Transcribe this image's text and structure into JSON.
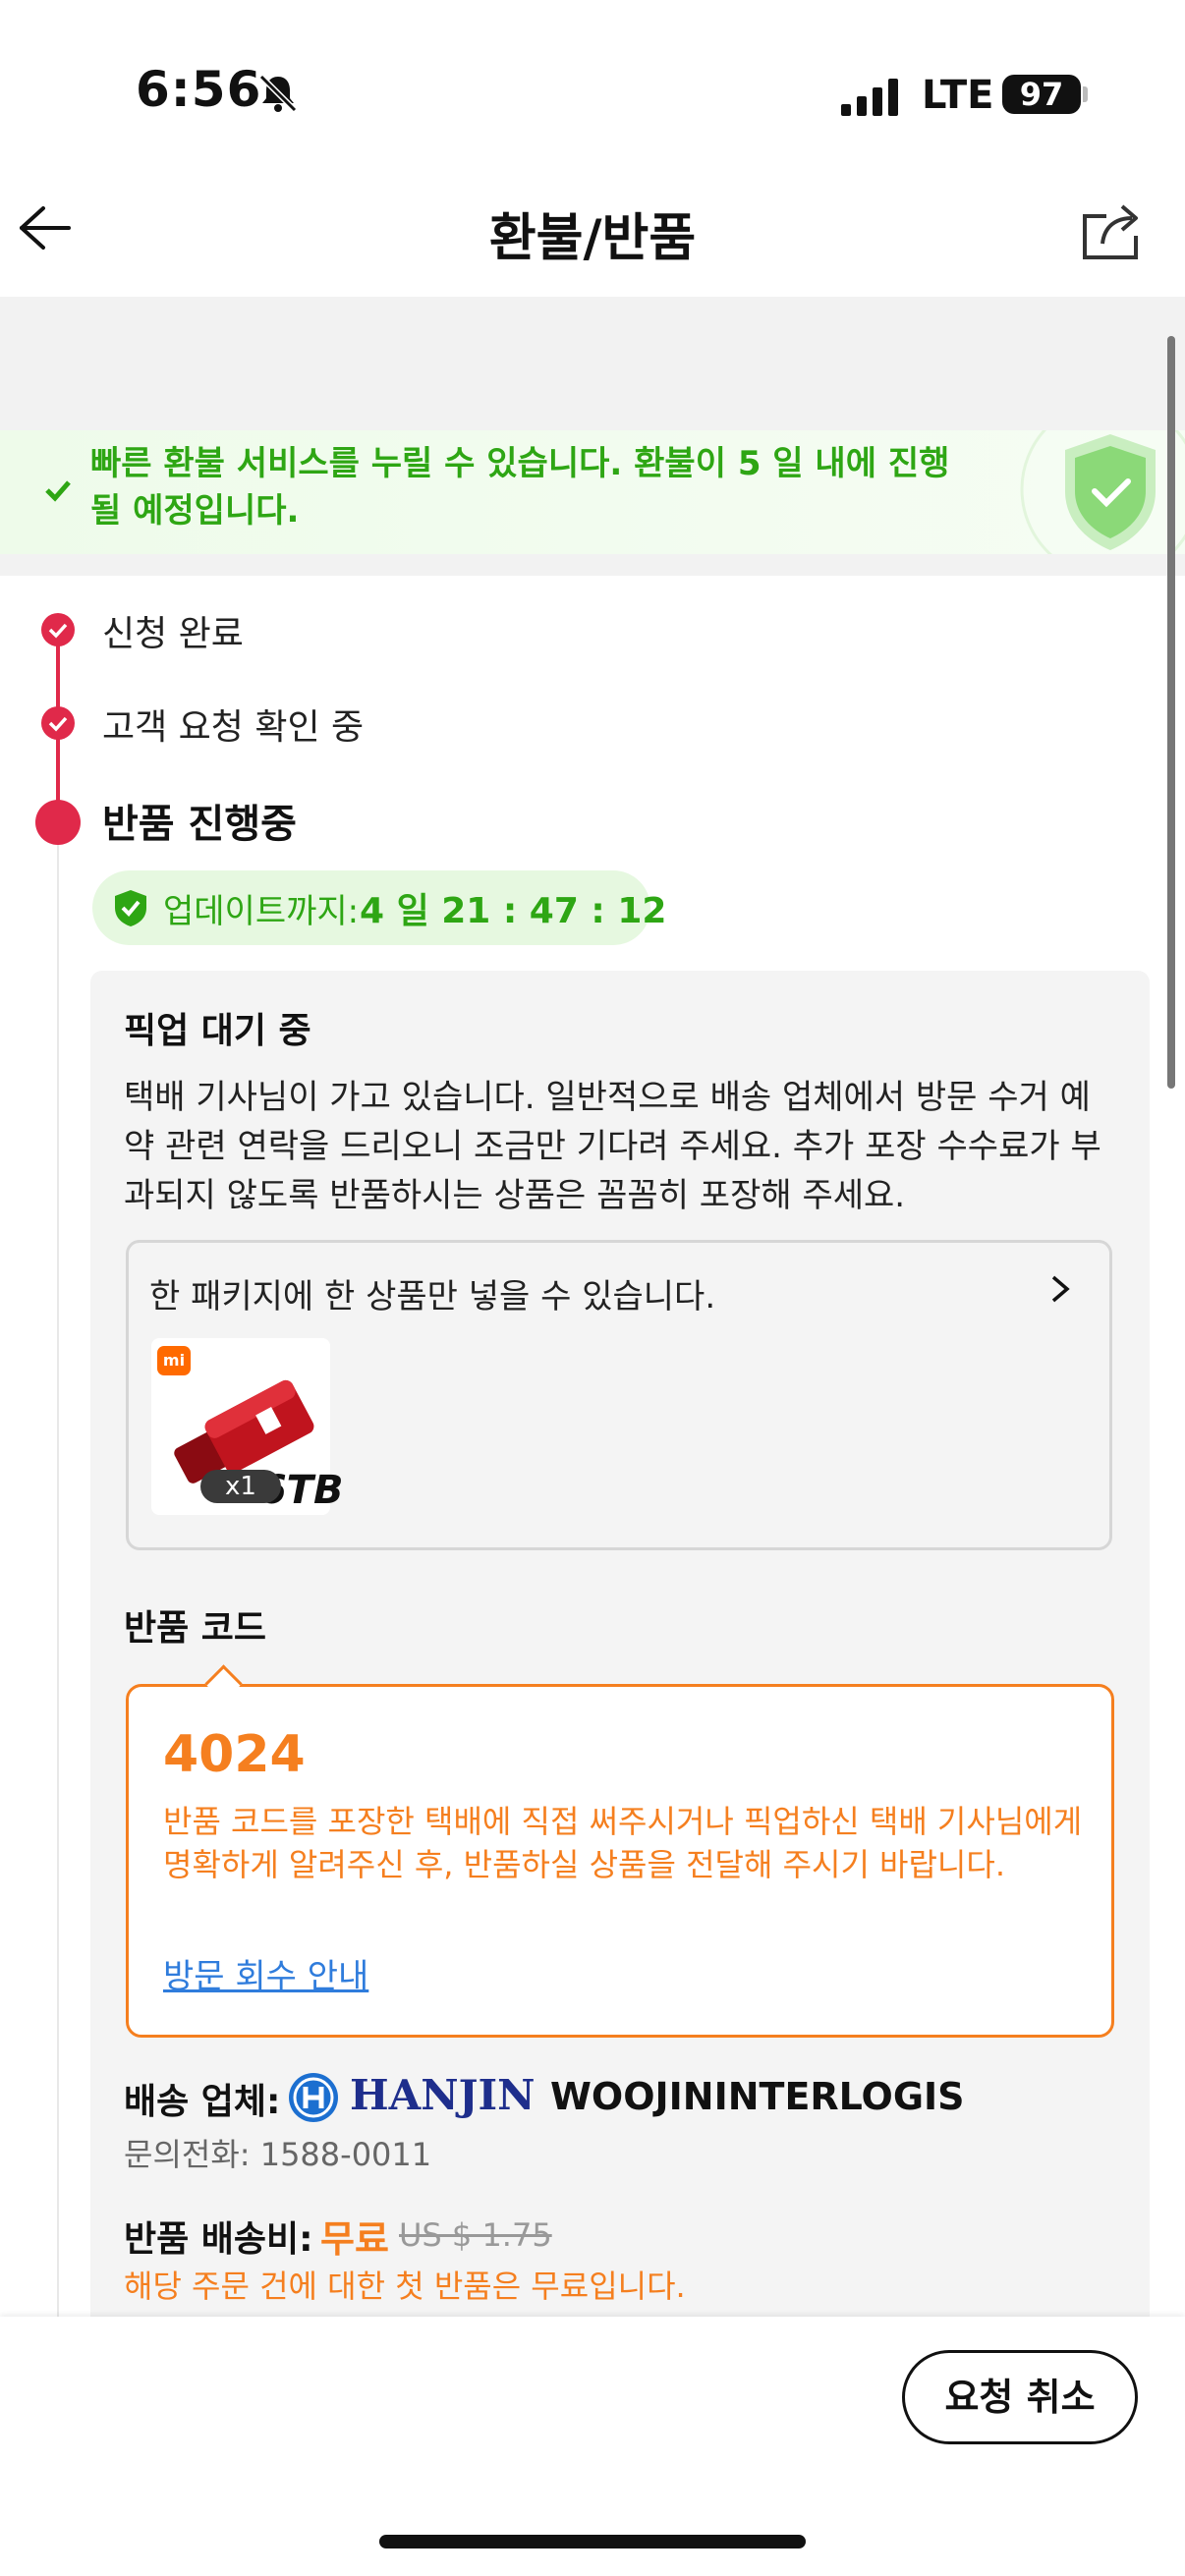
{
  "status_bar": {
    "time": "6:56",
    "network": "LTE",
    "battery": "97"
  },
  "header": {
    "title": "환불/반품"
  },
  "banner": {
    "text": "빠른 환불 서비스를 누릴 수 있습니다. 환불이 5 일 내에 진행될 예정입니다."
  },
  "steps": [
    {
      "label": "신청 완료"
    },
    {
      "label": "고객 요청 확인 중"
    },
    {
      "label": "반품 진행중"
    }
  ],
  "countdown": {
    "label": "업데이트까지:",
    "value": "4 일 21 : 47 : 12"
  },
  "pickup": {
    "title": "픽업 대기 중",
    "description": "택배 기사님이 가고 있습니다. 일반적으로 배송 업체에서 방문 수거 예약 관련 연락을 드리오니 조금만 기다려 주세요. 추가 포장 수수료가 부과되지 않도록 반품하시는 상품은 꼼꼼히 포장해 주세요."
  },
  "package": {
    "notice": "한 패키지에 한 상품만 넣을 수 있습니다.",
    "product": {
      "badge": "mi",
      "quantity": "x1",
      "overlay_text": "16TB"
    }
  },
  "return_code": {
    "title": "반품 코드",
    "code": "4024",
    "description": "반품 코드를 포장한 택배에 직접 써주시거나 픽업하신 택배 기사님에게 명확하게 알려주신 후, 반품하실 상품을 전달해 주시기 바랍니다.",
    "link": "방문 회수 안내"
  },
  "shipping": {
    "label": "배송 업체:",
    "logo_text": "HANJIN",
    "carrier": "WOOJININTERLOGIS",
    "phone": "문의전화: 1588-0011"
  },
  "fee": {
    "label": "반품 배송비:",
    "value": "무료",
    "original": "US $ 1.75",
    "note": "해당 주문 건에 대한 첫 반품은 무료입니다."
  },
  "actions": {
    "cancel": "요청 취소"
  },
  "colors": {
    "accent_red": "#e0294a",
    "accent_orange": "#f57f1f",
    "accent_green": "#2ea614",
    "link_blue": "#2f7cdc"
  }
}
